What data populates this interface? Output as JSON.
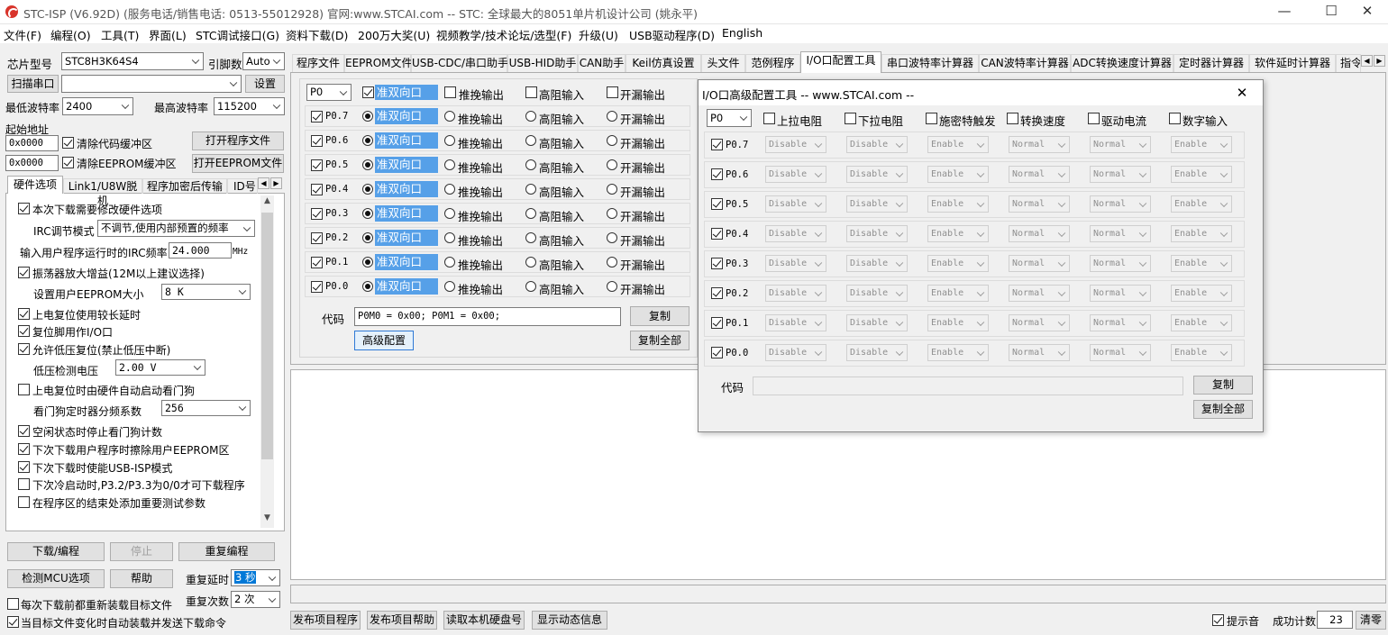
{
  "window": {
    "title": "STC-ISP (V6.92D) (服务电话/销售电话: 0513-55012928) 官网:www.STCAI.com  -- STC: 全球最大的8051单片机设计公司 (姚永平)",
    "minimize": "—",
    "maximize": "☐",
    "close": "✕"
  },
  "menu": [
    "文件(F)",
    "编程(O)",
    "工具(T)",
    "界面(L)",
    "STC调试接口(G)",
    "资料下载(D)",
    "200万大奖(U)",
    "视频教学/技术论坛/选型(F)",
    "升级(U)",
    "USB驱动程序(D)",
    "English"
  ],
  "left": {
    "chip_label": "芯片型号",
    "chip_value": "STC8H3K64S4",
    "pins_label": "引脚数",
    "pins_value": "Auto",
    "scan_port": "扫描串口",
    "settings": "设置",
    "min_baud_label": "最低波特率",
    "min_baud": "2400",
    "max_baud_label": "最高波特率",
    "max_baud": "115200",
    "start_addr": "起始地址",
    "addr1": "0x0000",
    "addr2": "0x0000",
    "clear_code": "清除代码缓冲区",
    "clear_eeprom": "清除EEPROM缓冲区",
    "open_prog": "打开程序文件",
    "open_eeprom": "打开EEPROM文件",
    "tabs": [
      "硬件选项",
      "Link1/U8W脱机",
      "程序加密后传输",
      "ID号"
    ],
    "opt_reconfig": "本次下载需要修改硬件选项",
    "irc_mode_label": "IRC调节模式",
    "irc_mode_value": "不调节,使用内部预置的频率",
    "irc_freq_label": "输入用户程序运行时的IRC频率",
    "irc_freq_value": "24.000",
    "irc_unit": "MHz",
    "opt_osc": "振荡器放大增益(12M以上建议选择)",
    "eeprom_size_label": "设置用户EEPROM大小",
    "eeprom_size": "8   K",
    "opt_por_delay": "上电复位使用较长延时",
    "opt_reset_io": "复位脚用作I/O口",
    "opt_lvr": "允许低压复位(禁止低压中断)",
    "lv_label": "低压检测电压",
    "lv_value": "2.00 V",
    "opt_wdt_hw": "上电复位时由硬件自动启动看门狗",
    "wdt_div_label": "看门狗定时器分频系数",
    "wdt_div": "256",
    "opt_idle_wdt": "空闲状态时停止看门狗计数",
    "opt_erase_eeprom": "下次下载用户程序时擦除用户EEPROM区",
    "opt_usb_isp": "下次下载时使能USB-ISP模式",
    "opt_cold_p32": "下次冷启动时,P3.2/P3.3为0/0才可下载程序",
    "opt_add_params": "在程序区的结束处添加重要测试参数",
    "download": "下载/编程",
    "stop": "停止",
    "reprogram": "重复编程",
    "check_mcu": "检测MCU选项",
    "help": "帮助",
    "repeat_delay_label": "重复延时",
    "repeat_delay": "3 秒",
    "repeat_count_label": "重复次数",
    "repeat_count": "2 次",
    "reload_each": "每次下载前都重新装载目标文件",
    "auto_reload": "当目标文件变化时自动装载并发送下载命令"
  },
  "tabs": [
    "程序文件",
    "EEPROM文件",
    "USB-CDC/串口助手",
    "USB-HID助手",
    "CAN助手",
    "Keil仿真设置",
    "头文件",
    "范例程序",
    "I/O口配置工具",
    "串口波特率计算器",
    "CAN波特率计算器",
    "ADC转换速度计算器",
    "定时器计算器",
    "软件延时计算器",
    "指令"
  ],
  "io": {
    "port": "P0",
    "modes": [
      "准双向口",
      "推挽输出",
      "高阻输入",
      "开漏输出"
    ],
    "pins": [
      "P0.7",
      "P0.6",
      "P0.5",
      "P0.4",
      "P0.3",
      "P0.2",
      "P0.1",
      "P0.0"
    ],
    "code_label": "代码",
    "code_value": "P0M0 = 0x00; P0M1 = 0x00;",
    "copy": "复制",
    "copy_all": "复制全部",
    "advanced": "高级配置"
  },
  "dialog": {
    "title": "I/O口高级配置工具 -- www.STCAI.com --",
    "port": "P0",
    "headers": [
      "上拉电阻",
      "下拉电阻",
      "施密特触发",
      "转换速度",
      "驱动电流",
      "数字输入"
    ],
    "cells": [
      "Disable",
      "Disable",
      "Enable",
      "Normal",
      "Normal",
      "Enable"
    ],
    "pins": [
      "P0.7",
      "P0.6",
      "P0.5",
      "P0.4",
      "P0.3",
      "P0.2",
      "P0.1",
      "P0.0"
    ],
    "code_label": "代码",
    "copy": "复制",
    "copy_all": "复制全部",
    "close": "✕"
  },
  "bottom": {
    "publish_prog": "发布项目程序",
    "publish_help": "发布项目帮助",
    "read_disk": "读取本机硬盘号",
    "show_dynamic": "显示动态信息",
    "beep": "提示音",
    "success_label": "成功计数",
    "success_count": "23",
    "clear": "清零"
  }
}
